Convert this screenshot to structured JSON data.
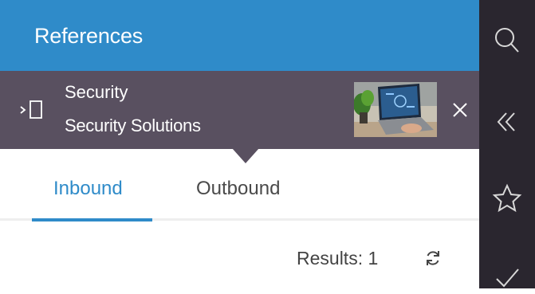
{
  "header": {
    "title": "References"
  },
  "context": {
    "open_icon": "open-in-icon",
    "line1": "Security",
    "line2": "Security Solutions",
    "thumbnail": "laptop-thumbnail-image",
    "close_icon": "close-icon"
  },
  "tabs": [
    {
      "label": "Inbound",
      "active": true
    },
    {
      "label": "Outbound",
      "active": false
    }
  ],
  "results": {
    "label": "Results: 1",
    "refresh_icon": "refresh-icon"
  },
  "rail": {
    "icons": [
      "search-icon",
      "collapse-double-chevron-icon",
      "star-icon",
      "check-icon"
    ]
  },
  "colors": {
    "accent": "#2f8bc9",
    "context_bg": "#595060",
    "rail_bg": "#2a262f",
    "text": "#4a4a4a"
  }
}
